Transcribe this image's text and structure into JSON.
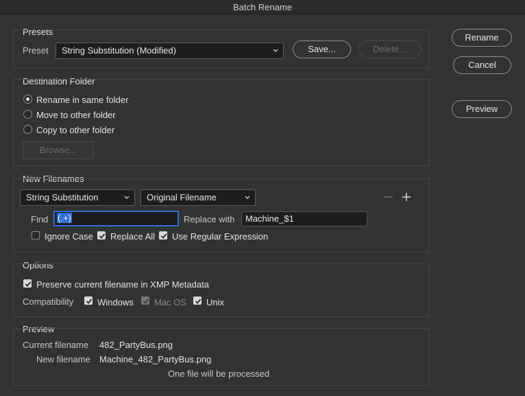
{
  "window": {
    "title": "Batch Rename"
  },
  "presets": {
    "section": "Presets",
    "preset_label": "Preset",
    "preset_value": "String Substitution (Modified)",
    "save_label": "Save...",
    "delete_label": "Delete..."
  },
  "destination": {
    "section": "Destination Folder",
    "options": [
      "Rename in same folder",
      "Move to other folder",
      "Copy to other folder"
    ],
    "selected": 0,
    "browse_label": "Browse..."
  },
  "new_filenames": {
    "section": "New Filenames",
    "type_value": "String Substitution",
    "target_value": "Original Filename",
    "find_label": "Find",
    "find_value": "(.+)",
    "replace_label": "Replace with",
    "replace_value": "Machine_$1",
    "ignore_case_label": "Ignore Case",
    "ignore_case": false,
    "replace_all_label": "Replace All",
    "replace_all": true,
    "regex_label": "Use Regular Expression",
    "regex": true
  },
  "options": {
    "section": "Options",
    "preserve_label": "Preserve current filename in XMP Metadata",
    "preserve": true,
    "compat_label": "Compatibility",
    "windows_label": "Windows",
    "windows": true,
    "macos_label": "Mac OS",
    "macos": true,
    "unix_label": "Unix",
    "unix": true
  },
  "preview": {
    "section": "Preview",
    "current_label": "Current filename",
    "current_value": "482_PartyBus.png",
    "new_label": "New filename",
    "new_value": "Machine_482_PartyBus.png",
    "status": "One file will be processed"
  },
  "actions": {
    "rename_label": "Rename",
    "cancel_label": "Cancel",
    "preview_label": "Preview"
  },
  "icons": {
    "remove": "minus-icon",
    "add": "plus-icon",
    "dropdown": "chevron-down-icon",
    "check": "checkmark-icon"
  },
  "colors": {
    "background": "#323232",
    "focus": "#2f6fd6"
  }
}
